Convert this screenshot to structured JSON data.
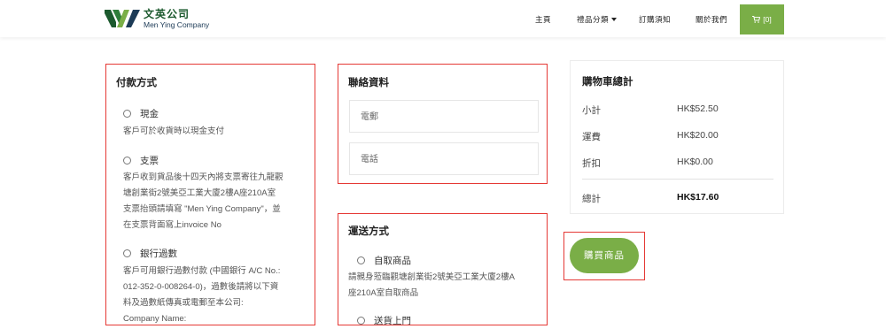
{
  "brand": {
    "name_cn": "文英公司",
    "name_en": "Men Ying Company",
    "colors": {
      "green": "#7aae47",
      "dark_green": "#1c5a2e",
      "navy": "#1c3a56",
      "highlight": "#e53935"
    }
  },
  "nav": {
    "home": "主頁",
    "categories": "禮品分類",
    "order_notes": "訂購須知",
    "about": "關於我們",
    "cart_count": "[0]",
    "cart_icon": "shopping-cart-icon"
  },
  "payment": {
    "title": "付款方式",
    "options": [
      {
        "label": "現金",
        "desc": [
          "客戶可於收貨時以現金支付"
        ]
      },
      {
        "label": "支票",
        "desc": [
          "客戶收到貨品後十四天內將支票寄往九龍觀",
          "塘創業街2號美亞工業大廈2樓A座210A室",
          "支票抬頭請填寫 \"Men Ying Company\"，並",
          "在支票背面寫上invoice No"
        ]
      },
      {
        "label": "銀行過數",
        "desc": [
          "客戶可用銀行過數付款 (中國銀行 A/C No.:",
          "012-352-0-008264-0)，過數後請將以下資",
          "料及過數紙傳真或電郵至本公司:",
          "Company Name:"
        ]
      }
    ]
  },
  "contact": {
    "title": "聯絡資料",
    "email_placeholder": "電郵",
    "phone_placeholder": "電話"
  },
  "shipping": {
    "title": "運送方式",
    "options": [
      {
        "label": "自取商品",
        "desc": [
          "請親身蒞臨觀塘創業街2號美亞工業大廈2樓A",
          "座210A室自取商品"
        ]
      },
      {
        "label": "送貨上門",
        "desc": []
      }
    ]
  },
  "summary": {
    "title": "購物車總計",
    "rows": [
      {
        "label": "小計",
        "value": "HK$52.50"
      },
      {
        "label": "運費",
        "value": "HK$20.00"
      },
      {
        "label": "折扣",
        "value": "HK$0.00"
      }
    ],
    "total_label": "總計",
    "total_value": "HK$17.60"
  },
  "buy_button": "購買商品"
}
